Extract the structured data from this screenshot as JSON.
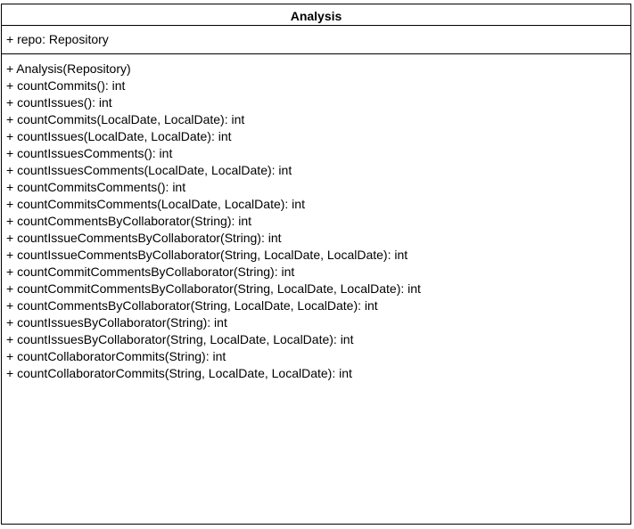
{
  "class": {
    "name": "Analysis",
    "attributes": [
      "+ repo: Repository"
    ],
    "operations": [
      "+ Analysis(Repository)",
      "+ countCommits(): int",
      "+ countIssues(): int",
      "+ countCommits(LocalDate, LocalDate): int",
      "+ countIssues(LocalDate, LocalDate): int",
      "+ countIssuesComments(): int",
      "+ countIssuesComments(LocalDate, LocalDate): int",
      "+ countCommitsComments(): int",
      "+ countCommitsComments(LocalDate, LocalDate): int",
      "+ countCommentsByCollaborator(String): int",
      "+ countIssueCommentsByCollaborator(String): int",
      "+ countIssueCommentsByCollaborator(String, LocalDate, LocalDate): int",
      "+ countCommitCommentsByCollaborator(String): int",
      "+ countCommitCommentsByCollaborator(String, LocalDate, LocalDate): int",
      "+ countCommentsByCollaborator(String, LocalDate, LocalDate): int",
      "+ countIssuesByCollaborator(String): int",
      "+ countIssuesByCollaborator(String, LocalDate, LocalDate): int",
      "+ countCollaboratorCommits(String): int",
      "+ countCollaboratorCommits(String, LocalDate, LocalDate): int"
    ]
  }
}
